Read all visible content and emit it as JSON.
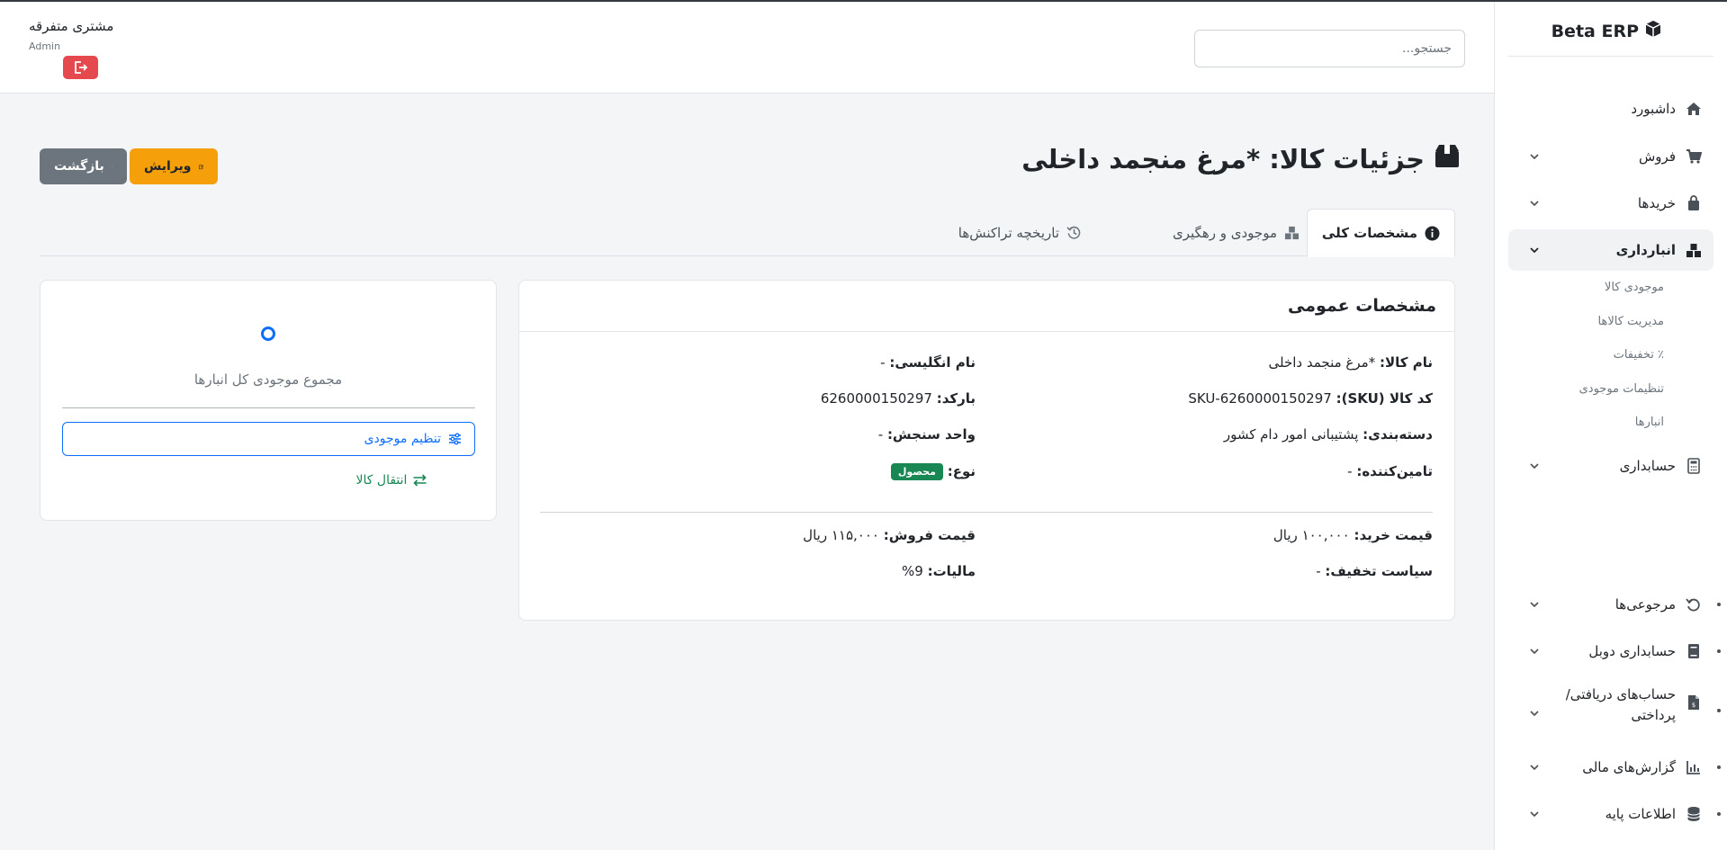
{
  "colors": {
    "primary": "#0d6efd",
    "warning": "#f59f0b",
    "secondary": "#6c757d",
    "danger": "#e5484d",
    "success": "#198754"
  },
  "brand": {
    "name": "Beta ERP",
    "icon": "box-icon"
  },
  "sidebar": {
    "items": [
      {
        "label": "داشبورد",
        "icon": "home-icon"
      },
      {
        "label": "فروش",
        "icon": "cart-icon"
      },
      {
        "label": "خریدها",
        "icon": "bag-icon"
      },
      {
        "label": "انبارداری",
        "icon": "boxes-icon"
      },
      {
        "label": "حسابداری",
        "icon": "calculator-icon"
      },
      {
        "label": "مرجوعی‌ها",
        "icon": "undo-icon"
      },
      {
        "label": "حسابداری دوبل",
        "icon": "book-icon"
      },
      {
        "label": "حساب‌های دریافتی/پرداختی",
        "icon": "invoice-icon"
      },
      {
        "label": "گزارش‌های مالی",
        "icon": "chart-icon"
      },
      {
        "label": "اطلاعات پایه",
        "icon": "database-icon"
      }
    ],
    "inventory_sub": [
      {
        "label": "موجودی کالا"
      },
      {
        "label": "مدیریت کالاها"
      },
      {
        "label": "٪ تخفیفات"
      },
      {
        "label": "تنظیمات موجودی"
      },
      {
        "label": "انبارها"
      }
    ]
  },
  "header": {
    "search_placeholder": "جستجو...",
    "user_name": "مشتری متفرقه",
    "user_role": "Admin"
  },
  "page": {
    "title": "جزئیات کالا: *مرغ منجمد داخلی",
    "edit_label": "ویرایش",
    "back_label": "بازگشت"
  },
  "tabs": [
    {
      "label": "مشخصات کلی",
      "icon": "info-icon",
      "active": true
    },
    {
      "label": "موجودی و رهگیری",
      "icon": "boxes-icon",
      "active": false
    },
    {
      "label": "تاریخچه تراکنش‌ها",
      "icon": "history-icon",
      "active": false
    }
  ],
  "general": {
    "title": "مشخصات عمومی",
    "name_label": "نام کالا:",
    "name_value": "*مرغ منجمد داخلی",
    "english_label": "نام انگلیسی:",
    "english_value": "-",
    "sku_label": "کد کالا (SKU):",
    "sku_value": "SKU-6260000150297",
    "barcode_label": "بارکد:",
    "barcode_value": "6260000150297",
    "category_label": "دسته‌بندی:",
    "category_value": "پشتیبانی امور دام کشور",
    "unit_label": "واحد سنجش:",
    "unit_value": "-",
    "supplier_label": "تامین‌کننده:",
    "supplier_value": "-",
    "type_label": "نوع:",
    "type_value": "محصول",
    "purchase_label": "قیمت خرید:",
    "purchase_value": "۱۰۰,۰۰۰ ریال",
    "sale_label": "قیمت فروش:",
    "sale_value": "۱۱۵,۰۰۰ ریال",
    "discount_label": "سیاست تخفیف:",
    "discount_value": "-",
    "tax_label": "مالیات:",
    "tax_value": "9%"
  },
  "stock": {
    "total_label": "مجموع موجودی کل انبارها",
    "adjust_label": "تنظیم موجودی",
    "transfer_label": "انتقال کالا"
  }
}
